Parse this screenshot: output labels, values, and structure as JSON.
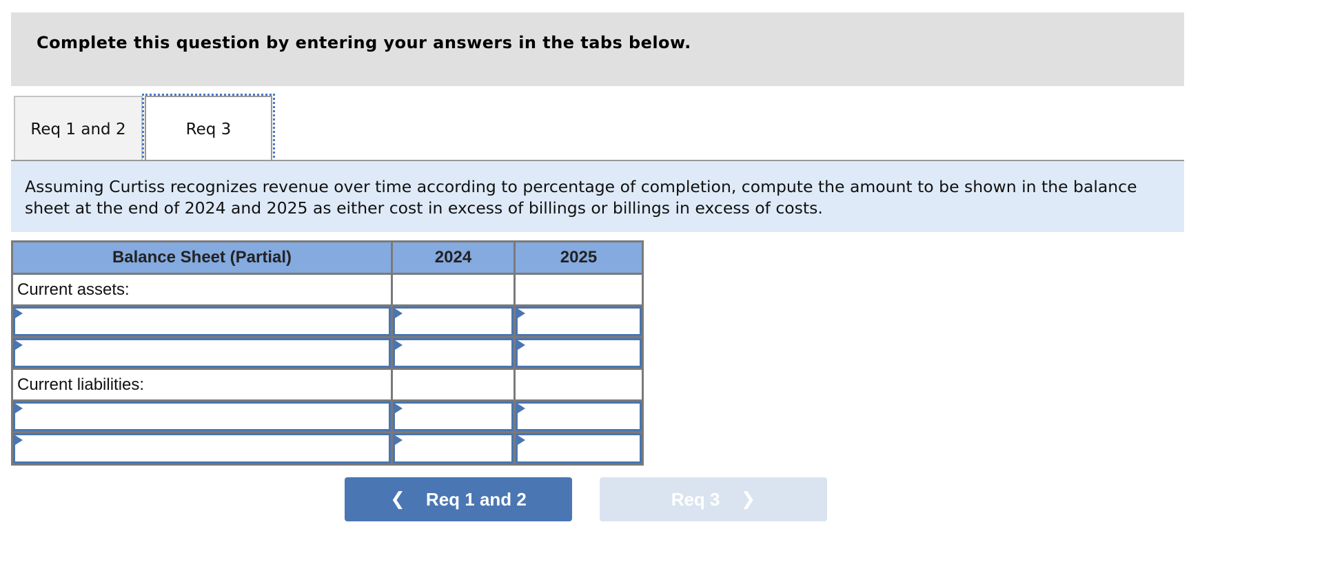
{
  "header": {
    "title": "Complete this question by entering your answers in the tabs below."
  },
  "tabs": [
    {
      "label": "Req 1 and 2",
      "active": false
    },
    {
      "label": "Req 3",
      "active": true
    }
  ],
  "instructions": "Assuming Curtiss recognizes revenue over time according to percentage of completion, compute the amount to be shown in the balance sheet at the end of 2024 and 2025 as either cost in excess of billings or billings in excess of costs.",
  "table": {
    "headers": [
      "Balance Sheet (Partial)",
      "2024",
      "2025"
    ],
    "sections": [
      {
        "label": "Current assets:",
        "inputs": [
          {
            "account": "",
            "y2024": "",
            "y2025": ""
          },
          {
            "account": "",
            "y2024": "",
            "y2025": ""
          }
        ]
      },
      {
        "label": "Current liabilities:",
        "inputs": [
          {
            "account": "",
            "y2024": "",
            "y2025": ""
          },
          {
            "account": "",
            "y2024": "",
            "y2025": ""
          }
        ]
      }
    ]
  },
  "navigation": {
    "prev_label": "Req 1 and 2",
    "prev_icon": "chevron-left-icon",
    "next_label": "Req 3",
    "next_icon": "chevron-right-icon",
    "next_enabled": false
  },
  "colors": {
    "header_band": "#e0e0e0",
    "info_box": "#deeaf7",
    "table_header": "#84aadf",
    "input_border": "#4a75b1",
    "primary_button": "#4a76b3",
    "disabled_button": "#dae4f0",
    "focus_ring": "#4a78bf"
  }
}
